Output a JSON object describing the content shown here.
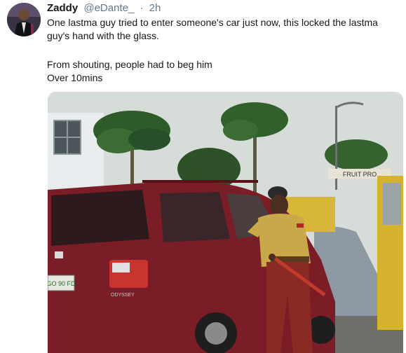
{
  "tweet": {
    "display_name": "Zaddy",
    "handle": "@eDante_",
    "separator": "·",
    "time": "2h",
    "lines": [
      "One lastma guy tried to enter someone's car just now, this locked the lastma",
      "guy's hand with the glass.",
      "From shouting, people had to beg him",
      "Over 10mins"
    ]
  },
  "photo": {
    "sign_text": "FRUIT PRO",
    "plate_text": "GO 90 FD",
    "car_badge": "ODYSSEY"
  },
  "colors": {
    "car": "#7b1d26",
    "uniform": "#c9a84a",
    "sky": "#d6dcd8"
  }
}
